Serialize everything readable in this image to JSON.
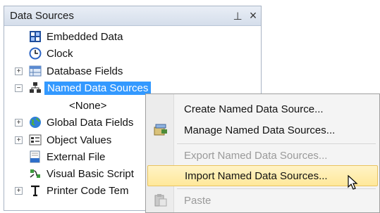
{
  "panel": {
    "title": "Data Sources",
    "pin_glyph": "⊥",
    "close_glyph": "×"
  },
  "tree": {
    "items": [
      {
        "label": "Embedded Data",
        "icon": "embedded-data-icon"
      },
      {
        "label": "Clock",
        "icon": "clock-icon"
      },
      {
        "label": "Database Fields",
        "icon": "database-fields-icon",
        "expander": "+"
      },
      {
        "label": "Named Data Sources",
        "icon": "named-data-sources-icon",
        "expander": "−",
        "selected": true
      },
      {
        "label": "<None>"
      },
      {
        "label": "Global Data Fields",
        "icon": "globe-icon",
        "expander": "+"
      },
      {
        "label": "Object Values",
        "icon": "object-values-icon",
        "expander": "+"
      },
      {
        "label": "External File",
        "icon": "external-file-icon"
      },
      {
        "label": "Visual Basic Script",
        "icon": "script-icon"
      },
      {
        "label": "Printer Code Tem",
        "icon": "printer-code-icon",
        "expander": "+"
      }
    ]
  },
  "context_menu": {
    "items": [
      {
        "label": "Create Named Data Source...",
        "enabled": true
      },
      {
        "label": "Manage Named Data Sources...",
        "enabled": true,
        "icon": "manage-icon"
      },
      {
        "label": "Export Named Data Sources...",
        "enabled": false
      },
      {
        "label": "Import Named Data Sources...",
        "enabled": true,
        "highlighted": true
      },
      {
        "label": "Paste",
        "enabled": false,
        "icon": "paste-icon"
      }
    ]
  },
  "colors": {
    "selection": "#3399ff",
    "highlight": "#ffe89a",
    "disabled_text": "#9a9a9a"
  }
}
